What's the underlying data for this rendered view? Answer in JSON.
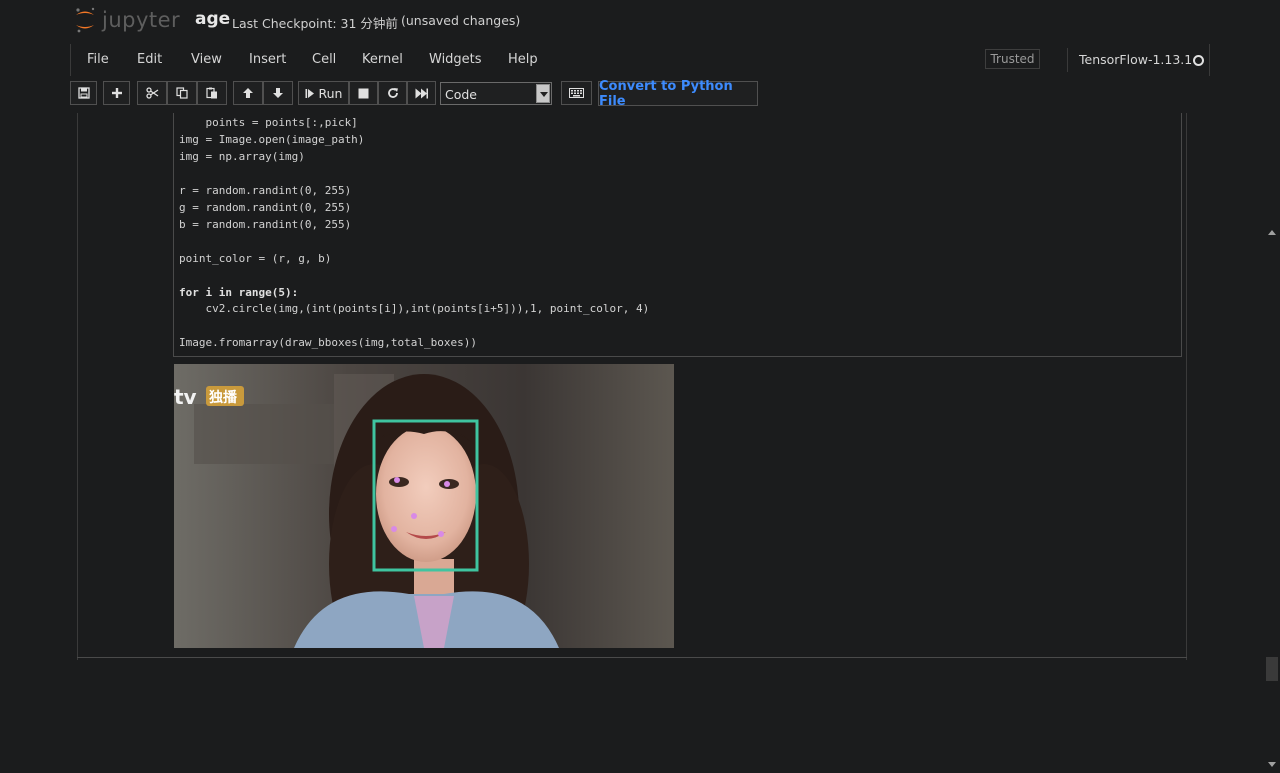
{
  "header": {
    "logo_text": "jupyter",
    "notebook_name": "age",
    "checkpoint": "Last Checkpoint: 31 分钟前",
    "autosave": "(unsaved changes)"
  },
  "menubar": {
    "items": [
      "File",
      "Edit",
      "View",
      "Insert",
      "Cell",
      "Kernel",
      "Widgets",
      "Help"
    ],
    "trusted": "Trusted",
    "kernel_name": "TensorFlow-1.13.1"
  },
  "toolbar": {
    "run_label": "Run",
    "cell_type": "Code",
    "convert_label": "Convert to Python File"
  },
  "cell": {
    "code_lines": [
      "    points = points[:,pick]",
      "img = Image.open(image_path)",
      "img = np.array(img)",
      "",
      "r = random.randint(0, 255)",
      "g = random.randint(0, 255)",
      "b = random.randint(0, 255)",
      "",
      "point_color = (r, g, b)",
      "",
      "for i in range(5):",
      "    cv2.circle(img,(int(points[i]),int(points[i+5])),1, point_color, 4)",
      "",
      "Image.fromarray(draw_bboxes(img,total_boxes))"
    ]
  },
  "output": {
    "watermark_text": "tv",
    "watermark_badge": "独播",
    "bbox_color": "#3fc4a0",
    "landmark_color": "#d88ae6"
  },
  "colors": {
    "background": "#1b1c1d",
    "accent_link": "#3d8bfd",
    "logo_orange": "#f37726"
  }
}
